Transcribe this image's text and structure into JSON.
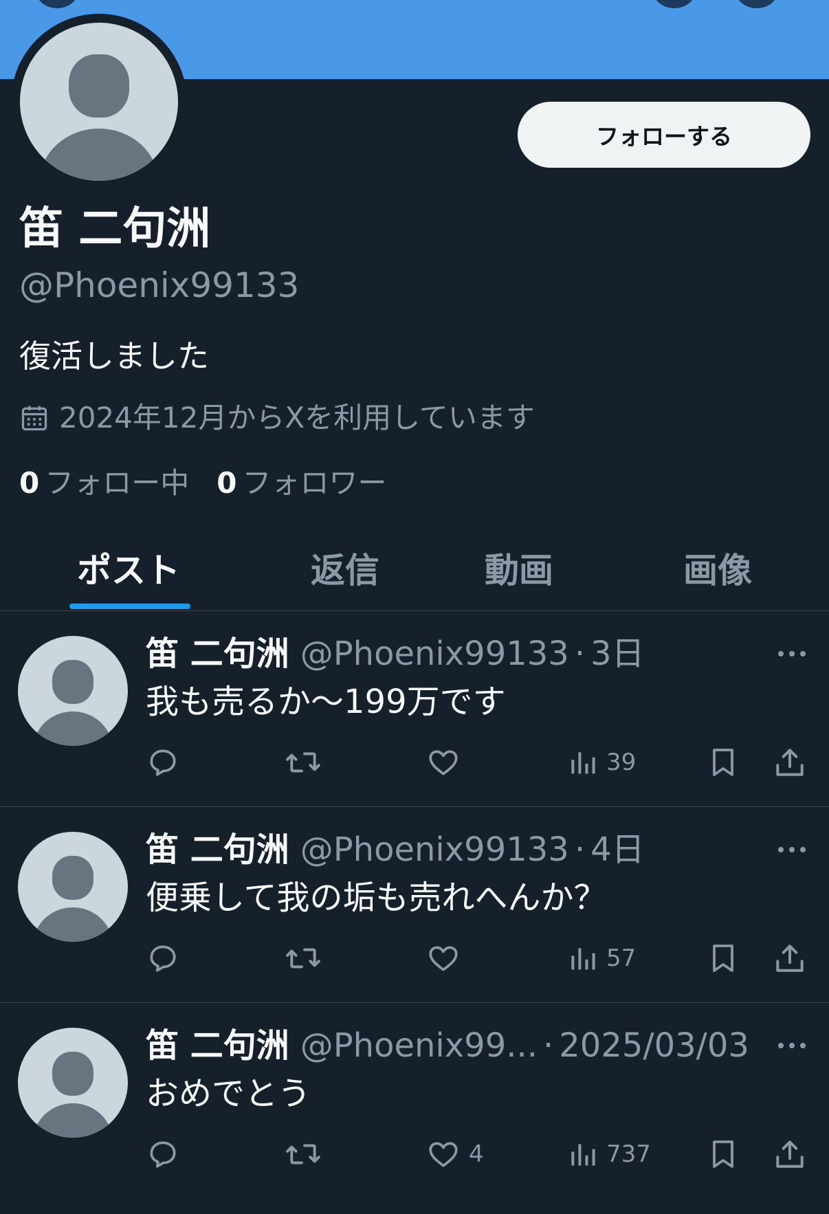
{
  "profile": {
    "display_name": "笛 二句洲",
    "handle": "@Phoenix99133",
    "bio": "復活しました",
    "joined": "2024年12月からXを利用しています",
    "follow_button": "フォローする",
    "following_count": "0",
    "following_label": "フォロー中",
    "followers_count": "0",
    "followers_label": "フォロワー"
  },
  "tabs": [
    {
      "label": "ポスト",
      "active": true
    },
    {
      "label": "返信",
      "active": false
    },
    {
      "label": "動画",
      "active": false
    },
    {
      "label": "画像",
      "active": false
    }
  ],
  "posts": [
    {
      "name": "笛 二句洲",
      "handle": "@Phoenix99133",
      "time": "3日",
      "text": "我も売るか〜199万です",
      "likes": "",
      "views": "39"
    },
    {
      "name": "笛 二句洲",
      "handle": "@Phoenix99133",
      "time": "4日",
      "text": "便乗して我の垢も売れへんか？",
      "likes": "",
      "views": "57"
    },
    {
      "name": "笛 二句洲",
      "handle": "@Phoenix99...",
      "time": "2025/03/03",
      "text": "おめでとう",
      "likes": "4",
      "views": "737"
    }
  ],
  "dot": "·",
  "icons": [
    "calendar-icon",
    "reply-icon",
    "retweet-icon",
    "like-icon",
    "views-icon",
    "bookmark-icon",
    "share-icon",
    "more-icon"
  ],
  "colors": {
    "background": "#15202b",
    "banner": "#4a99e9",
    "accent": "#1d9bf0",
    "text": "#f7f9f9",
    "secondary": "#8b98a5"
  }
}
